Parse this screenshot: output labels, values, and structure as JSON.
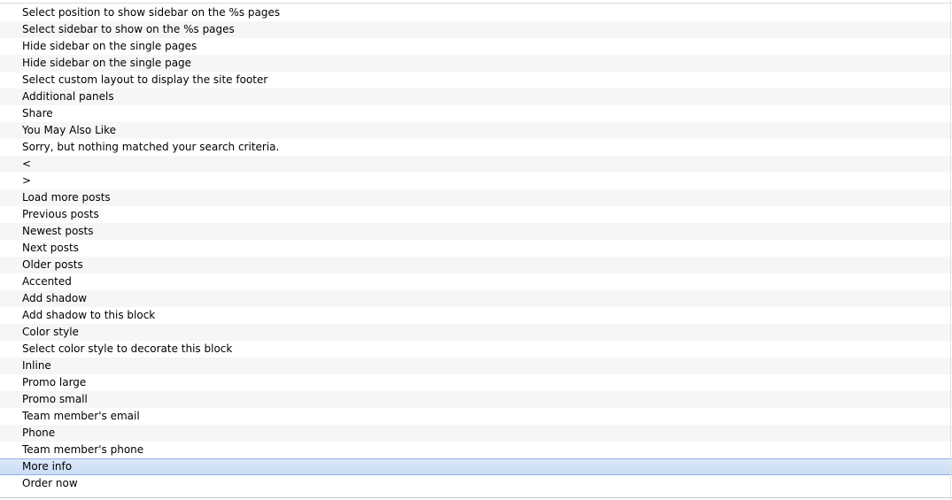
{
  "list": {
    "selected_index": 27,
    "items": [
      "Select position to show sidebar on the %s pages",
      "Select sidebar to show on the %s pages",
      "Hide sidebar on the single pages",
      "Hide sidebar on the single page",
      "Select custom layout to display the site footer",
      "Additional panels",
      "Share",
      "You May Also Like",
      "Sorry, but nothing matched your search criteria.",
      "<",
      ">",
      "Load more posts",
      "Previous posts",
      "Newest posts",
      "Next posts",
      "Older posts",
      "Accented",
      "Add shadow",
      "Add shadow to this block",
      "Color style",
      "Select color style to decorate this block",
      "Inline",
      "Promo large",
      "Promo small",
      "Team member's email",
      "Phone",
      "Team member's phone",
      "More info",
      "Order now"
    ]
  }
}
